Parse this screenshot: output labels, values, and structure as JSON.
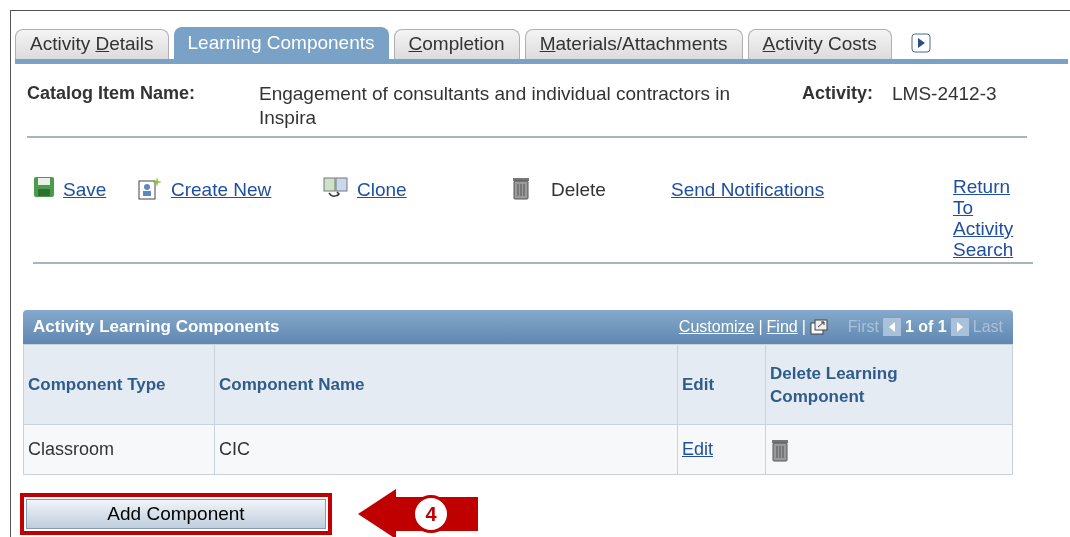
{
  "tabs": [
    {
      "before": "Activity ",
      "key": "D",
      "after": "etails",
      "selected": false
    },
    {
      "before": "Learning Components",
      "selected": true
    },
    {
      "key": "C",
      "after": "ompletion",
      "selected": false
    },
    {
      "key": "M",
      "after": "aterials/Attachments",
      "selected": false
    },
    {
      "key": "A",
      "after": "ctivity Costs",
      "selected": false
    }
  ],
  "header": {
    "catalog_label": "Catalog Item Name:",
    "catalog_value": "Engagement of consultants and individual contractors in Inspira",
    "activity_label": "Activity:",
    "activity_value": "LMS-2412-3"
  },
  "toolbar": [
    {
      "kind": "save",
      "label": "Save",
      "link": true
    },
    {
      "kind": "create",
      "label": "Create New",
      "link": true
    },
    {
      "kind": "clone",
      "label": "Clone",
      "link": true
    },
    {
      "kind": "delete",
      "label": "Delete",
      "link": false
    },
    {
      "kind": "notify",
      "label": "Send Notifications",
      "link": true
    },
    {
      "kind": "return",
      "label": "Return To Activity Search",
      "link": true
    }
  ],
  "grid": {
    "title": "Activity Learning Components",
    "customize": "Customize",
    "find": "Find",
    "separator": "|",
    "first": "First",
    "count": "1 of 1",
    "last": "Last",
    "columns": [
      "Component Type",
      "Component Name",
      "Edit",
      "Delete Learning Component"
    ],
    "rows": [
      {
        "type": "Classroom",
        "name": "CIC",
        "edit": "Edit"
      }
    ]
  },
  "add_button": "Add Component",
  "callout": "4"
}
